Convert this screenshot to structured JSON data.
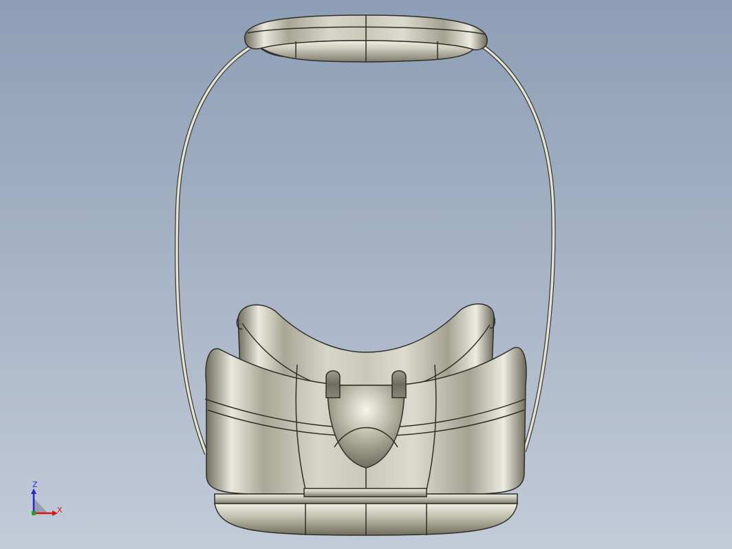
{
  "viewport": {
    "background_top": "#8d9eb6",
    "background_bottom": "#c2cbd8",
    "model": "vr-headset-with-strap"
  },
  "triad": {
    "z_label": "Z",
    "x_label": "X",
    "z_color": "#1f2bd0",
    "x_color": "#d41818"
  }
}
